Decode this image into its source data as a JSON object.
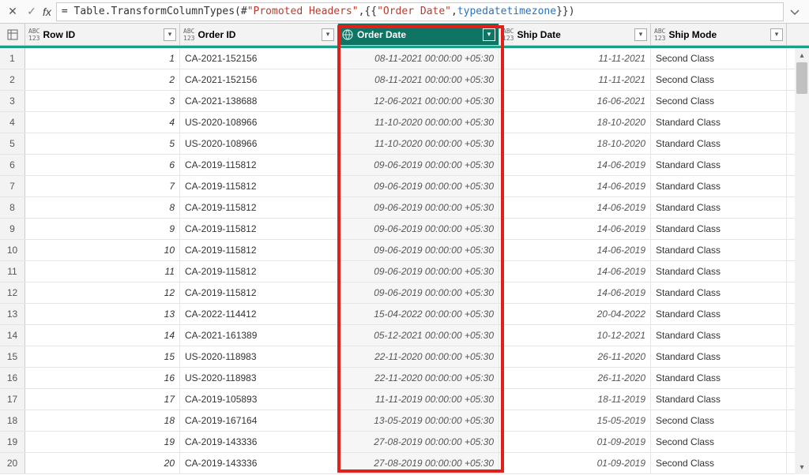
{
  "formula": {
    "prefix": "= Table.TransformColumnTypes(#",
    "arg_string": "\"Promoted Headers\"",
    "mid1": ",{{",
    "col_string": "\"Order Date\"",
    "mid2": ", ",
    "type_kw": "type",
    "space": " ",
    "type_name": "datetimezone",
    "suffix": "}})"
  },
  "columns": {
    "row_id": "Row ID",
    "order_id": "Order ID",
    "order_date": "Order Date",
    "ship_date": "Ship Date",
    "ship_mode": "Ship Mode"
  },
  "type_labels": {
    "abc123_top": "ABC",
    "abc123_bot": "123",
    "dtz": "⊕"
  },
  "chart_data": {
    "type": "table",
    "columns": [
      "Row ID",
      "Order ID",
      "Order Date",
      "Ship Date",
      "Ship Mode"
    ],
    "rows": [
      {
        "n": 1,
        "row_id": "1",
        "order_id": "CA-2021-152156",
        "order_date": "08-11-2021 00:00:00 +05:30",
        "ship_date": "11-11-2021",
        "ship_mode": "Second Class"
      },
      {
        "n": 2,
        "row_id": "2",
        "order_id": "CA-2021-152156",
        "order_date": "08-11-2021 00:00:00 +05:30",
        "ship_date": "11-11-2021",
        "ship_mode": "Second Class"
      },
      {
        "n": 3,
        "row_id": "3",
        "order_id": "CA-2021-138688",
        "order_date": "12-06-2021 00:00:00 +05:30",
        "ship_date": "16-06-2021",
        "ship_mode": "Second Class"
      },
      {
        "n": 4,
        "row_id": "4",
        "order_id": "US-2020-108966",
        "order_date": "11-10-2020 00:00:00 +05:30",
        "ship_date": "18-10-2020",
        "ship_mode": "Standard Class"
      },
      {
        "n": 5,
        "row_id": "5",
        "order_id": "US-2020-108966",
        "order_date": "11-10-2020 00:00:00 +05:30",
        "ship_date": "18-10-2020",
        "ship_mode": "Standard Class"
      },
      {
        "n": 6,
        "row_id": "6",
        "order_id": "CA-2019-115812",
        "order_date": "09-06-2019 00:00:00 +05:30",
        "ship_date": "14-06-2019",
        "ship_mode": "Standard Class"
      },
      {
        "n": 7,
        "row_id": "7",
        "order_id": "CA-2019-115812",
        "order_date": "09-06-2019 00:00:00 +05:30",
        "ship_date": "14-06-2019",
        "ship_mode": "Standard Class"
      },
      {
        "n": 8,
        "row_id": "8",
        "order_id": "CA-2019-115812",
        "order_date": "09-06-2019 00:00:00 +05:30",
        "ship_date": "14-06-2019",
        "ship_mode": "Standard Class"
      },
      {
        "n": 9,
        "row_id": "9",
        "order_id": "CA-2019-115812",
        "order_date": "09-06-2019 00:00:00 +05:30",
        "ship_date": "14-06-2019",
        "ship_mode": "Standard Class"
      },
      {
        "n": 10,
        "row_id": "10",
        "order_id": "CA-2019-115812",
        "order_date": "09-06-2019 00:00:00 +05:30",
        "ship_date": "14-06-2019",
        "ship_mode": "Standard Class"
      },
      {
        "n": 11,
        "row_id": "11",
        "order_id": "CA-2019-115812",
        "order_date": "09-06-2019 00:00:00 +05:30",
        "ship_date": "14-06-2019",
        "ship_mode": "Standard Class"
      },
      {
        "n": 12,
        "row_id": "12",
        "order_id": "CA-2019-115812",
        "order_date": "09-06-2019 00:00:00 +05:30",
        "ship_date": "14-06-2019",
        "ship_mode": "Standard Class"
      },
      {
        "n": 13,
        "row_id": "13",
        "order_id": "CA-2022-114412",
        "order_date": "15-04-2022 00:00:00 +05:30",
        "ship_date": "20-04-2022",
        "ship_mode": "Standard Class"
      },
      {
        "n": 14,
        "row_id": "14",
        "order_id": "CA-2021-161389",
        "order_date": "05-12-2021 00:00:00 +05:30",
        "ship_date": "10-12-2021",
        "ship_mode": "Standard Class"
      },
      {
        "n": 15,
        "row_id": "15",
        "order_id": "US-2020-118983",
        "order_date": "22-11-2020 00:00:00 +05:30",
        "ship_date": "26-11-2020",
        "ship_mode": "Standard Class"
      },
      {
        "n": 16,
        "row_id": "16",
        "order_id": "US-2020-118983",
        "order_date": "22-11-2020 00:00:00 +05:30",
        "ship_date": "26-11-2020",
        "ship_mode": "Standard Class"
      },
      {
        "n": 17,
        "row_id": "17",
        "order_id": "CA-2019-105893",
        "order_date": "11-11-2019 00:00:00 +05:30",
        "ship_date": "18-11-2019",
        "ship_mode": "Standard Class"
      },
      {
        "n": 18,
        "row_id": "18",
        "order_id": "CA-2019-167164",
        "order_date": "13-05-2019 00:00:00 +05:30",
        "ship_date": "15-05-2019",
        "ship_mode": "Second Class"
      },
      {
        "n": 19,
        "row_id": "19",
        "order_id": "CA-2019-143336",
        "order_date": "27-08-2019 00:00:00 +05:30",
        "ship_date": "01-09-2019",
        "ship_mode": "Second Class"
      },
      {
        "n": 20,
        "row_id": "20",
        "order_id": "CA-2019-143336",
        "order_date": "27-08-2019 00:00:00 +05:30",
        "ship_date": "01-09-2019",
        "ship_mode": "Second Class"
      }
    ]
  }
}
